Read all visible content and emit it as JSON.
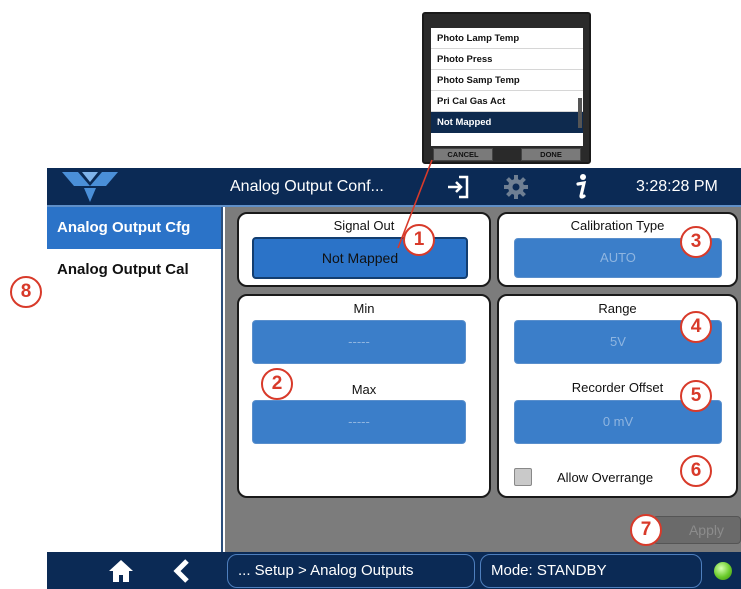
{
  "popup": {
    "items": [
      "Photo Lamp Temp",
      "Photo Press",
      "Photo Samp Temp",
      "Pri Cal Gas Act",
      "Not Mapped"
    ],
    "cancel_label": "CANCEL",
    "done_label": "DONE"
  },
  "header": {
    "title": "Analog Output Conf...",
    "time": "3:28:28 PM",
    "icons": [
      "logo-icon",
      "login-icon",
      "gear-icon",
      "info-icon"
    ]
  },
  "sidebar": {
    "items": [
      {
        "label": "Analog Output Cfg",
        "active": true
      },
      {
        "label": "Analog Output Cal",
        "active": false
      }
    ]
  },
  "main": {
    "signal_out": {
      "label": "Signal Out",
      "value": "Not Mapped"
    },
    "calibration_type": {
      "label": "Calibration Type",
      "value": "AUTO"
    },
    "min": {
      "label": "Min",
      "value": "-----"
    },
    "max": {
      "label": "Max",
      "value": "-----"
    },
    "range": {
      "label": "Range",
      "value": "5V"
    },
    "recorder_offset": {
      "label": "Recorder Offset",
      "value": "0 mV"
    },
    "allow_overrange": {
      "label": "Allow Overrange",
      "checked": false
    },
    "apply_label": "Apply"
  },
  "footer": {
    "breadcrumb": "... Setup > Analog Outputs",
    "mode": "Mode: STANDBY",
    "status_led": "#6acb2a"
  },
  "callouts": [
    "1",
    "2",
    "3",
    "4",
    "5",
    "6",
    "7",
    "8"
  ],
  "colors": {
    "navy": "#0b2a55",
    "accent_blue": "#2b73c8",
    "callout_red": "#d83a2a"
  }
}
